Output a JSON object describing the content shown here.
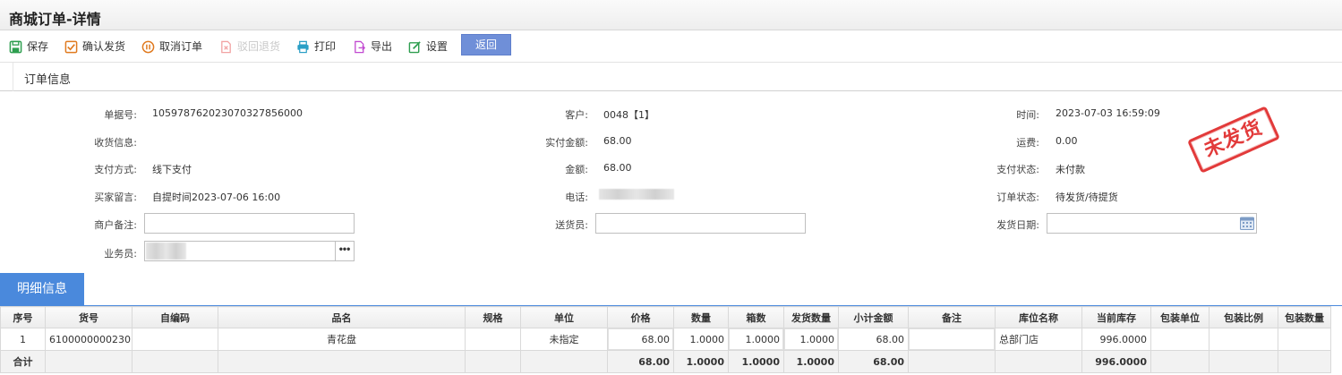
{
  "page": {
    "title": "商城订单-详情"
  },
  "toolbar": {
    "save": "保存",
    "confirm_ship": "确认发货",
    "cancel_order": "取消订单",
    "reject_return": "驳回退货",
    "print": "打印",
    "export": "导出",
    "settings": "设置",
    "back": "返回"
  },
  "order_section": {
    "label": "订单信息"
  },
  "order": {
    "doc_no_label": "单据号:",
    "doc_no": "105978762023070327856000",
    "customer_label": "客户:",
    "customer": "0048【1】",
    "time_label": "时间:",
    "time": "2023-07-03 16:59:09",
    "consignee_label": "收货信息:",
    "consignee": "",
    "paid_label": "实付金额:",
    "paid": "68.00",
    "freight_label": "运费:",
    "freight": "0.00",
    "pay_method_label": "支付方式:",
    "pay_method": "线下支付",
    "amount_label": "金额:",
    "amount": "68.00",
    "pay_status_label": "支付状态:",
    "pay_status": "未付款",
    "buyer_msg_label": "买家留言:",
    "buyer_msg": "自提时间2023-07-06 16:00",
    "phone_label": "电话:",
    "order_status_label": "订单状态:",
    "order_status": "待发货/待提货",
    "merchant_note_label": "商户备注:",
    "merchant_note": "",
    "courier_label": "送货员:",
    "courier": "",
    "ship_date_label": "发货日期:",
    "ship_date": "",
    "salesman_label": "业务员:",
    "stamp": "未发货"
  },
  "detail_tab": {
    "label": "明细信息"
  },
  "grid": {
    "headers": [
      "序号",
      "货号",
      "自编码",
      "品名",
      "规格",
      "单位",
      "价格",
      "数量",
      "箱数",
      "发货数量",
      "小计金额",
      "备注",
      "库位名称",
      "当前库存",
      "包装单位",
      "包装比例",
      "包装数量"
    ],
    "rows": [
      [
        "1",
        "6100000000230",
        "",
        "青花盘",
        "",
        "未指定",
        "68.00",
        "1.0000",
        "1.0000",
        "1.0000",
        "68.00",
        "",
        "总部门店",
        "996.0000",
        "",
        "",
        ""
      ]
    ],
    "total": [
      "合计",
      "",
      "",
      "",
      "",
      "",
      "68.00",
      "1.0000",
      "1.0000",
      "1.0000",
      "68.00",
      "",
      "",
      "996.0000",
      "",
      "",
      ""
    ]
  }
}
